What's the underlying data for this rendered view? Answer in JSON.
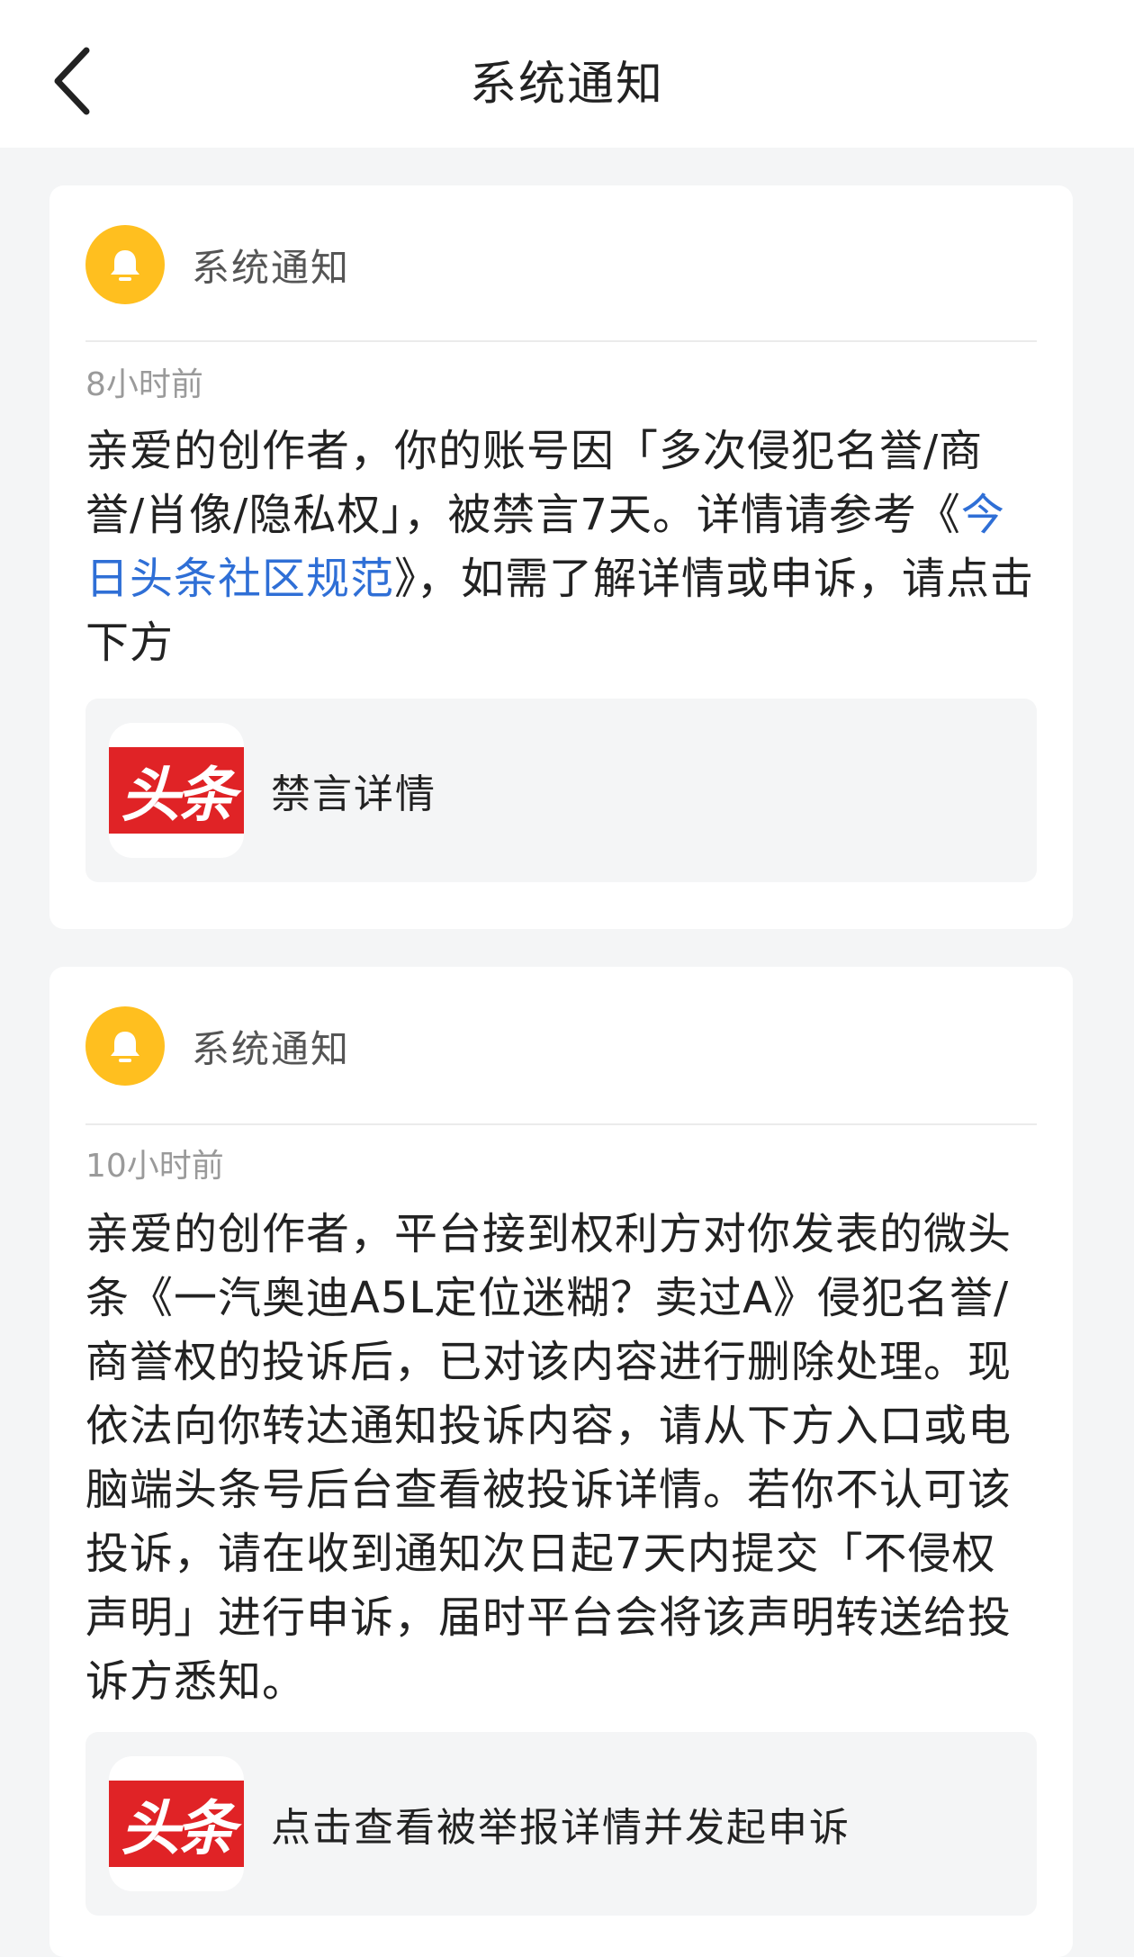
{
  "header": {
    "title": "系统通知",
    "back_icon": "chevron-left-icon"
  },
  "colors": {
    "bell_bg": "#ffbf1f",
    "link": "#2f6fd6",
    "logo_red": "#e02326"
  },
  "notifications": [
    {
      "sender": "系统通知",
      "icon": "bell-icon",
      "time": "8小时前",
      "text_before": "亲爱的创作者，你的账号因「多次侵犯名誉/商誉/肖像/隐私权」，被禁言7天。详情请参考《",
      "link_text": "今日头条社区规范",
      "text_after": "》，如需了解详情或申诉，请点击下方",
      "action": {
        "logo_text": "头条",
        "label": "禁言详情"
      }
    },
    {
      "sender": "系统通知",
      "icon": "bell-icon",
      "time": "10小时前",
      "text": "亲爱的创作者，平台接到权利方对你发表的微头条《一汽奥迪A5L定位迷糊？卖过A》侵犯名誉/商誉权的投诉后，已对该内容进行删除处理。现依法向你转达通知投诉内容，请从下方入口或电脑端头条号后台查看被投诉详情。若你不认可该投诉，请在收到通知次日起7天内提交「不侵权声明」进行申诉，届时平台会将该声明转送给投诉方悉知。",
      "action": {
        "logo_text": "头条",
        "label": "点击查看被举报详情并发起申诉"
      }
    }
  ]
}
